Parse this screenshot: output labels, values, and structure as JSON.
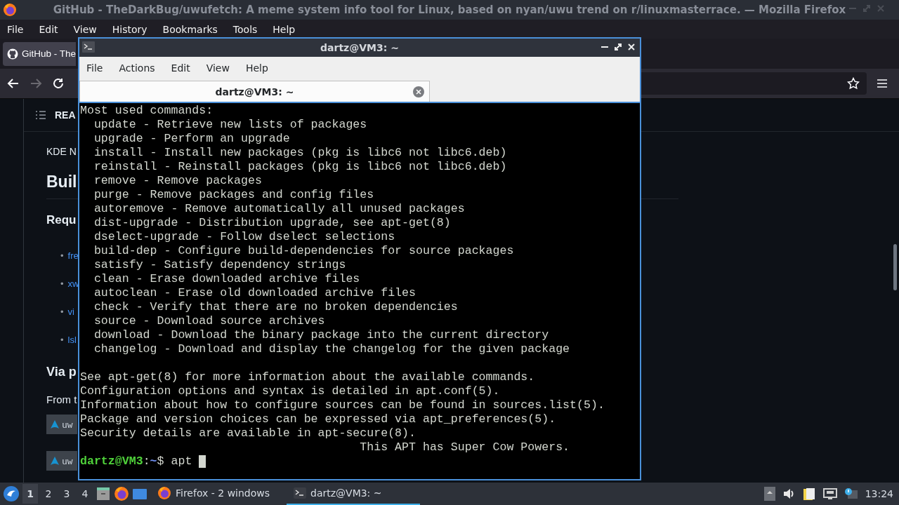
{
  "firefox": {
    "title": "GitHub - TheDarkBug/uwufetch: A meme system info tool for Linux, based on nyan/uwu trend on r/linuxmasterrace. — Mozilla Firefox",
    "menu": [
      "File",
      "Edit",
      "View",
      "History",
      "Bookmarks",
      "Tools",
      "Help"
    ],
    "tabs": [
      {
        "label": "GitHub - The",
        "selected": true
      }
    ],
    "forward_disabled": true,
    "page": {
      "header": "REA",
      "paragraph": "KDE N",
      "heading": "Buil",
      "subheading": "Requ",
      "requirements": [
        {
          "marker": "•",
          "text": "fre"
        },
        {
          "marker": "•",
          "text": "xw"
        },
        {
          "marker": "•",
          "text": "vi"
        },
        {
          "marker": "•",
          "text": "lsl"
        }
      ],
      "section_heading": "Via p",
      "section_text": "From t",
      "install_buttons": [
        "uw",
        "uw"
      ]
    }
  },
  "terminal": {
    "title": "dartz@VM3: ~",
    "menu": [
      "File",
      "Actions",
      "Edit",
      "View",
      "Help"
    ],
    "tabs": [
      {
        "label": "dartz@VM3: ~",
        "selected": true
      }
    ],
    "output_blocks": [
      [
        "Most used commands:",
        "  update - Retrieve new lists of packages",
        "  upgrade - Perform an upgrade",
        "  install - Install new packages (pkg is libc6 not libc6.deb)",
        "  reinstall - Reinstall packages (pkg is libc6 not libc6.deb)",
        "  remove - Remove packages",
        "  purge - Remove packages and config files",
        "  autoremove - Remove automatically all unused packages",
        "  dist-upgrade - Distribution upgrade, see apt-get(8)",
        "  dselect-upgrade - Follow dselect selections",
        "  build-dep - Configure build-dependencies for source packages",
        "  satisfy - Satisfy dependency strings",
        "  clean - Erase downloaded archive files",
        "  autoclean - Erase old downloaded archive files",
        "  check - Verify that there are no broken dependencies",
        "  source - Download source archives",
        "  download - Download the binary package into the current directory",
        "  changelog - Download and display the changelog for the given package"
      ],
      [
        "See apt-get(8) for more information about the available commands.",
        "Configuration options and syntax is detailed in apt.conf(5).",
        "Information about how to configure sources can be found in sources.list(5).",
        "Package and version choices can be expressed via apt_preferences(5).",
        "Security details are available in apt-secure(8).",
        "                                        This APT has Super Cow Powers."
      ]
    ],
    "prompt": {
      "user_host": "dartz@VM3",
      "separator": ":",
      "path": "~",
      "symbol": "$",
      "command": "apt"
    }
  },
  "taskbar": {
    "desktops": [
      {
        "label": "1",
        "selected": true
      },
      {
        "label": "2",
        "selected": false
      },
      {
        "label": "3",
        "selected": false
      },
      {
        "label": "4",
        "selected": false
      }
    ],
    "tasks": [
      {
        "kind": "firefox",
        "label": "Firefox - 2 windows",
        "selected": false
      },
      {
        "kind": "terminal",
        "label": "dartz@VM3: ~",
        "selected": true
      }
    ],
    "clock": "13:24"
  }
}
